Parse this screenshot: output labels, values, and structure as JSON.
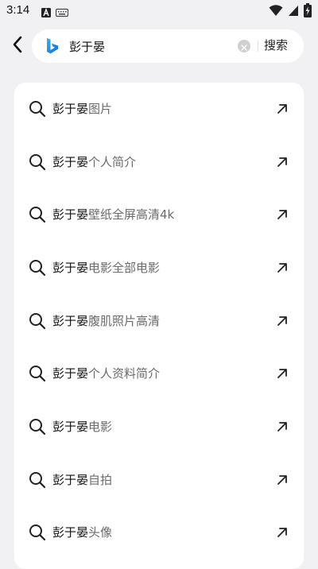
{
  "status_bar": {
    "time": "3:14",
    "icons": [
      "font-a-icon",
      "keyboard-icon",
      "wifi-icon",
      "signal-icon",
      "battery-charging-icon"
    ]
  },
  "search": {
    "query": "彭于晏",
    "search_button_label": "搜索",
    "icons": [
      "back-arrow-icon",
      "bing-logo-icon",
      "clear-icon"
    ]
  },
  "suggestions": [
    {
      "query": "彭于晏",
      "completion": "图片"
    },
    {
      "query": "彭于晏",
      "completion": "个人简介"
    },
    {
      "query": "彭于晏",
      "completion": "壁纸全屏高清4k"
    },
    {
      "query": "彭于晏",
      "completion": "电影全部电影"
    },
    {
      "query": "彭于晏",
      "completion": "腹肌照片高清"
    },
    {
      "query": "彭于晏",
      "completion": "个人资料简介"
    },
    {
      "query": "彭于晏",
      "completion": "电影"
    },
    {
      "query": "彭于晏",
      "completion": "自拍"
    },
    {
      "query": "彭于晏",
      "completion": "头像"
    }
  ],
  "suggestion_icons": [
    "search-icon",
    "fill-query-arrow-icon"
  ],
  "colors": {
    "background": "#f1f1f3",
    "card": "#ffffff",
    "query_text": "#111111",
    "completion_text": "#6b6b6b",
    "bing_blue": "#1b8fe4"
  }
}
